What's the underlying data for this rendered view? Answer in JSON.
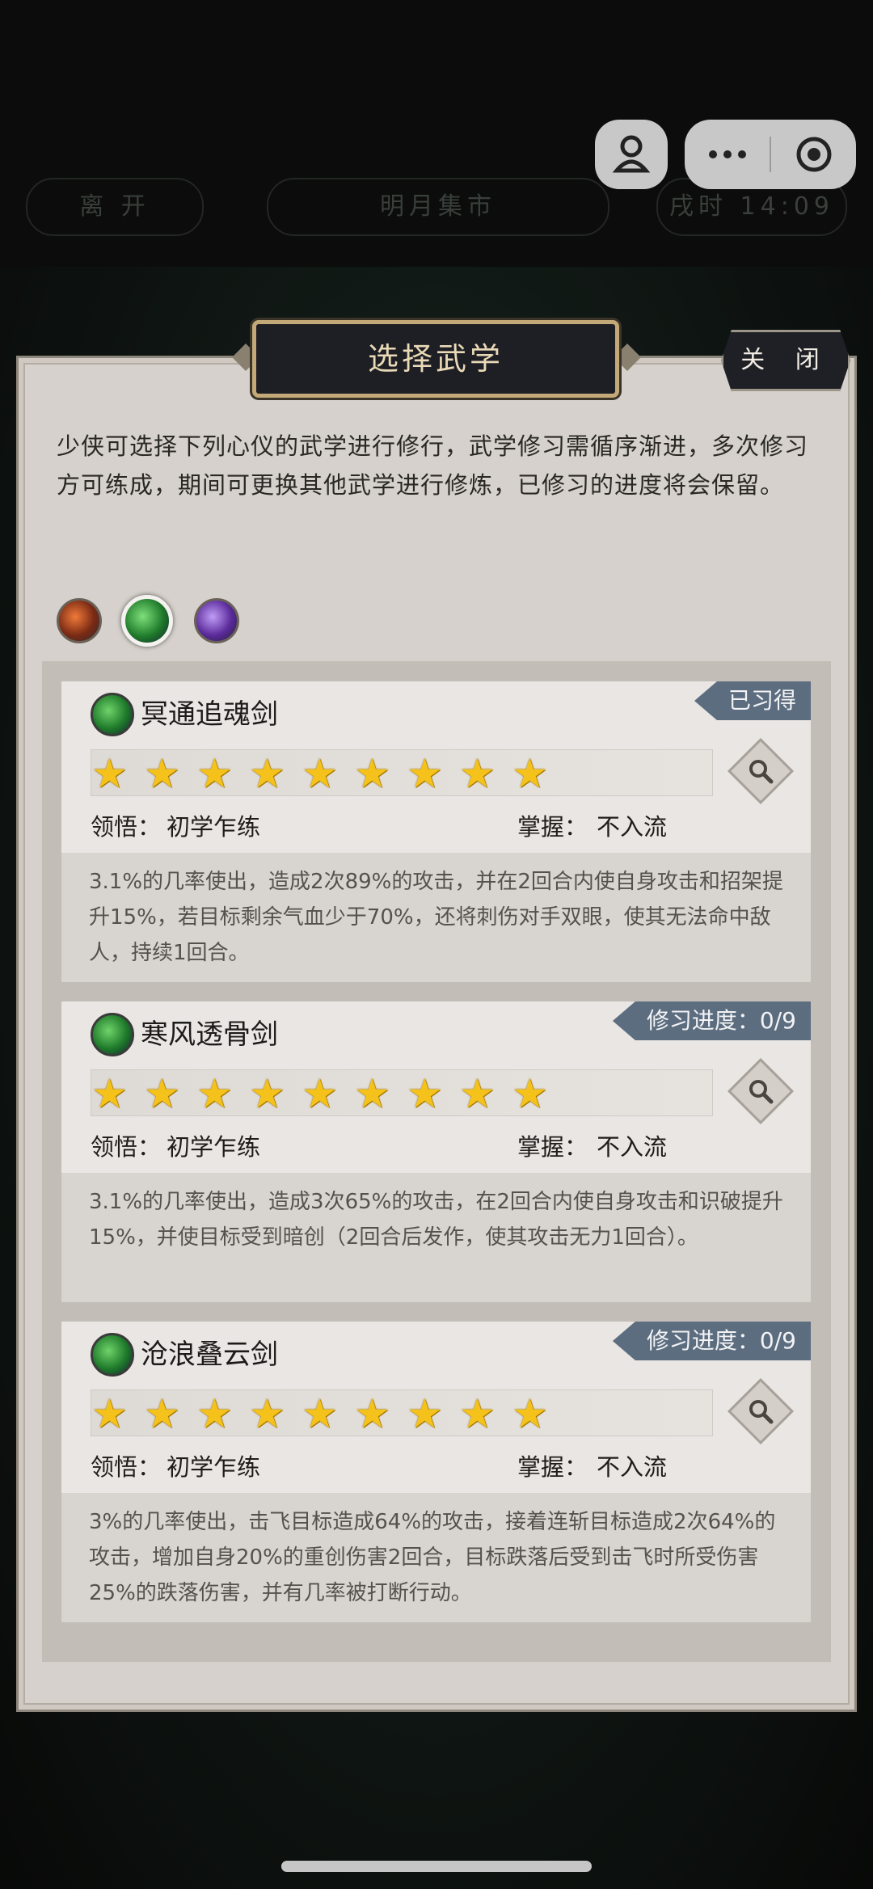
{
  "top_nav": {
    "leave": "离 开",
    "location": "明月集市",
    "time": "戌时 14:09"
  },
  "capsule": {
    "more_icon": "more-dots-icon",
    "close_icon": "record-target-icon"
  },
  "dialog": {
    "title": "选择武学",
    "close_label": "关 闭",
    "intro": "少侠可选择下列心仪的武学进行修行，武学修习需循序渐进，多次修习方可练成，期间可更换其他武学进行修炼，已修习的进度将会保留。"
  },
  "filters": [
    {
      "name": "fist-style-icon",
      "active": false
    },
    {
      "name": "sword-style-icon",
      "active": true
    },
    {
      "name": "spear-style-icon",
      "active": false
    }
  ],
  "labels": {
    "comprehension": "领悟：",
    "mastery": "掌握："
  },
  "skills": [
    {
      "name": "冥通追魂剑",
      "status": "已习得",
      "stars": 9,
      "comprehension": "初学乍练",
      "mastery": "不入流",
      "desc": "3.1%的几率使出，造成2次89%的攻击，并在2回合内使自身攻击和招架提升15%，若目标剩余气血少于70%，还将刺伤对手双眼，使其无法命中敌人，持续1回合。"
    },
    {
      "name": "寒风透骨剑",
      "status": "修习进度：0/9",
      "stars": 9,
      "comprehension": "初学乍练",
      "mastery": "不入流",
      "desc": "3.1%的几率使出，造成3次65%的攻击，在2回合内使自身攻击和识破提升15%，并使目标受到暗创（2回合后发作，使其攻击无力1回合）。"
    },
    {
      "name": "沧浪叠云剑",
      "status": "修习进度：0/9",
      "stars": 9,
      "comprehension": "初学乍练",
      "mastery": "不入流",
      "desc": "3%的几率使出，击飞目标造成64%的攻击，接着连斩目标造成2次64%的攻击，增加自身20%的重创伤害2回合，目标跌落后受到击飞时所受伤害25%的跌落伤害，并有几率被打断行动。"
    }
  ]
}
